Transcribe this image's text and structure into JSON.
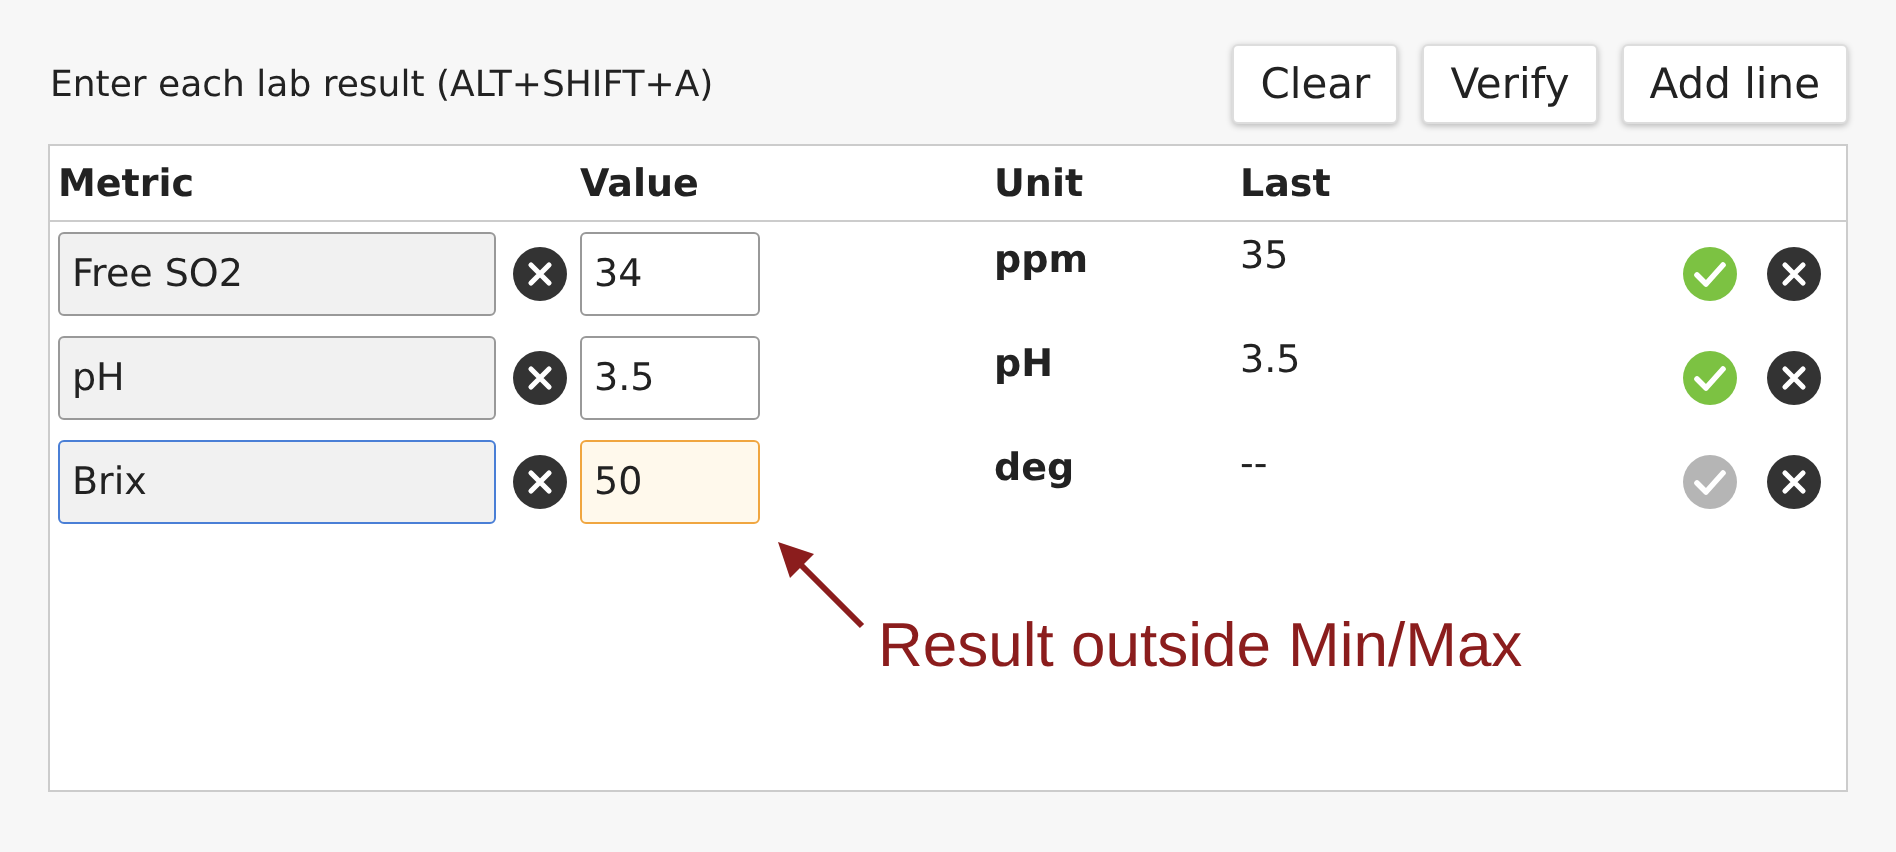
{
  "header": {
    "title": "Enter each lab result (ALT+SHIFT+A)",
    "buttons": [
      "Clear",
      "Verify",
      "Add line"
    ]
  },
  "table": {
    "columns": [
      "Metric",
      "Value",
      "Unit",
      "Last"
    ],
    "rows": [
      {
        "metric": "Free SO2",
        "focused": false,
        "value": "34",
        "out_of_range": false,
        "unit": "ppm",
        "last": "35",
        "verified": true
      },
      {
        "metric": "pH",
        "focused": false,
        "value": "3.5",
        "out_of_range": false,
        "unit": "pH",
        "last": "3.5",
        "verified": true
      },
      {
        "metric": "Brix",
        "focused": true,
        "value": "50",
        "out_of_range": true,
        "unit": "deg",
        "last": "--",
        "verified": false
      }
    ]
  },
  "annotation": {
    "text": "Result outside Min/Max"
  }
}
